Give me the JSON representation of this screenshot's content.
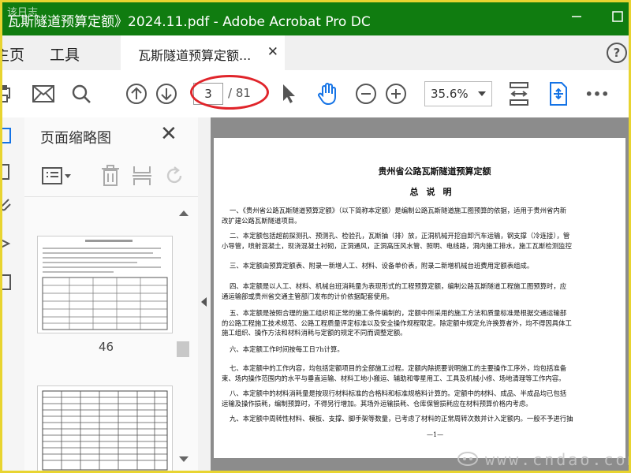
{
  "window": {
    "title": "瓦斯隧道预算定额》2024.11.pdf - Adobe Acrobat Pro DC",
    "minimize_icon": "minimize-icon",
    "maximize_icon": "maximize-icon"
  },
  "menu": {
    "home": "主页",
    "tools": "工具",
    "doc_tab": "瓦斯隧道预算定额...",
    "close_icon": "close-icon",
    "help_icon": "help-icon"
  },
  "toolbar": {
    "current_page": "3",
    "total_pages": "/ 81",
    "zoom": "35.6%",
    "more": "•••",
    "icons": [
      "print-icon",
      "email-icon",
      "search-icon",
      "page-up-icon",
      "page-down-icon",
      "select-arrow-icon",
      "hand-tool-icon",
      "zoom-out-icon",
      "zoom-in-icon",
      "zoom-dropdown-icon",
      "fit-page-icon",
      "scroll-mode-icon",
      "more-icon"
    ],
    "highlight_color": "#e0242a"
  },
  "side_panel": {
    "title": "页面缩略图",
    "thumbnail_label": "46",
    "tool_icons": [
      "options-menu-icon",
      "delete-page-icon",
      "extract-page-icon",
      "rotate-page-icon"
    ]
  },
  "document": {
    "heading": "贵州省公路瓦斯隧道预算定额",
    "subheading": "总说明",
    "paragraphs": [
      [
        "一、《贵州省公路瓦斯隧道预算定额》（以下简称本定额）是编制公路瓦斯隧道施工图预算的依据，适用于贵州省内新",
        "改扩建公路瓦斯隧道项目。"
      ],
      [
        "二、本定额包括超前探测孔、预测孔、检验孔，瓦斯抽（排）放，正洞机械开挖自卸汽车运输，钢支撑（冷连接），管",
        "小导管，喷射混凝土，现浇混凝土衬砌，正洞通风，正洞高压风水管、照明、电线路，洞内施工排水，施工瓦斯检测监控"
      ],
      [
        "三、本定额由预算定额表、附录一新增人工、材料、设备单价表，附录二新增机械台班费用定额表组成。"
      ],
      [
        "四、本定额是以人工、材料、机械台班消耗量为表现形式的工程预算定额，编制公路瓦斯隧道工程施工图预算时，应",
        "通运输部或贵州省交通主管部门发布的计价依据配套使用。"
      ],
      [
        "五、本定额是按照合理的施工组织和正常的施工条件编制的，定额中所采用的施工方法和质量标准是根据交通运输部",
        "的公路工程施工技术规范、公路工程质量评定标准以及安全操作规程取定。除定额中规定允许换算者外，均不得因具体工",
        "施工组织、操作方法和材料消耗与定额的规定不同而调整定额。"
      ],
      [
        "六、本定额工作时间按每工日7h计算。"
      ],
      [
        "七、本定额中的工作内容，均包括定额项目的全部施工过程。定额内除扼要说明施工的主要操作工序外，均包括准备",
        "束、场内操作范围内的水平与垂直运输、材料工地小搬运、辅助和零星用工、工具及机械小修、场地清理等工作内容。"
      ],
      [
        "八、本定额中的材料消耗量是按现行材料标准的合格料和标准规格料计算的。定额中的材料、成品、半成品均已包括",
        "运输及操作损耗，编制预算时，不得另行增加。其场外运输损耗、仓库保管损耗应在材料预算价格内考虑。"
      ],
      [
        "九、本定额中周转性材料、模板、支撑、脚手架等数量，已考虑了材料的正常周转次数并计入定额内。一般不予进行抽"
      ]
    ],
    "page_footer": "—1—"
  },
  "watermark": {
    "text": "www.cndao.com",
    "corner": "该日志"
  }
}
